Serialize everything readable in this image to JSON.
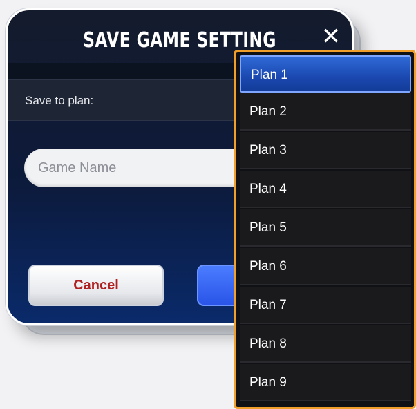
{
  "dialog": {
    "title": "SAVE GAME SETTING",
    "close_glyph": "✕",
    "save_to_plan_label": "Save to plan:",
    "game_name_placeholder": "Game Name",
    "cancel_label": "Cancel"
  },
  "dropdown": {
    "selected": "Plan 1",
    "options": [
      "Plan 1",
      "Plan 2",
      "Plan 3",
      "Plan 4",
      "Plan 5",
      "Plan 6",
      "Plan 7",
      "Plan 8",
      "Plan 9"
    ]
  },
  "colors": {
    "dropdown_border": "#f0a02a",
    "selected_option": "#1b48b0",
    "cancel_text": "#b02020",
    "save_button": "#2a55e8"
  }
}
